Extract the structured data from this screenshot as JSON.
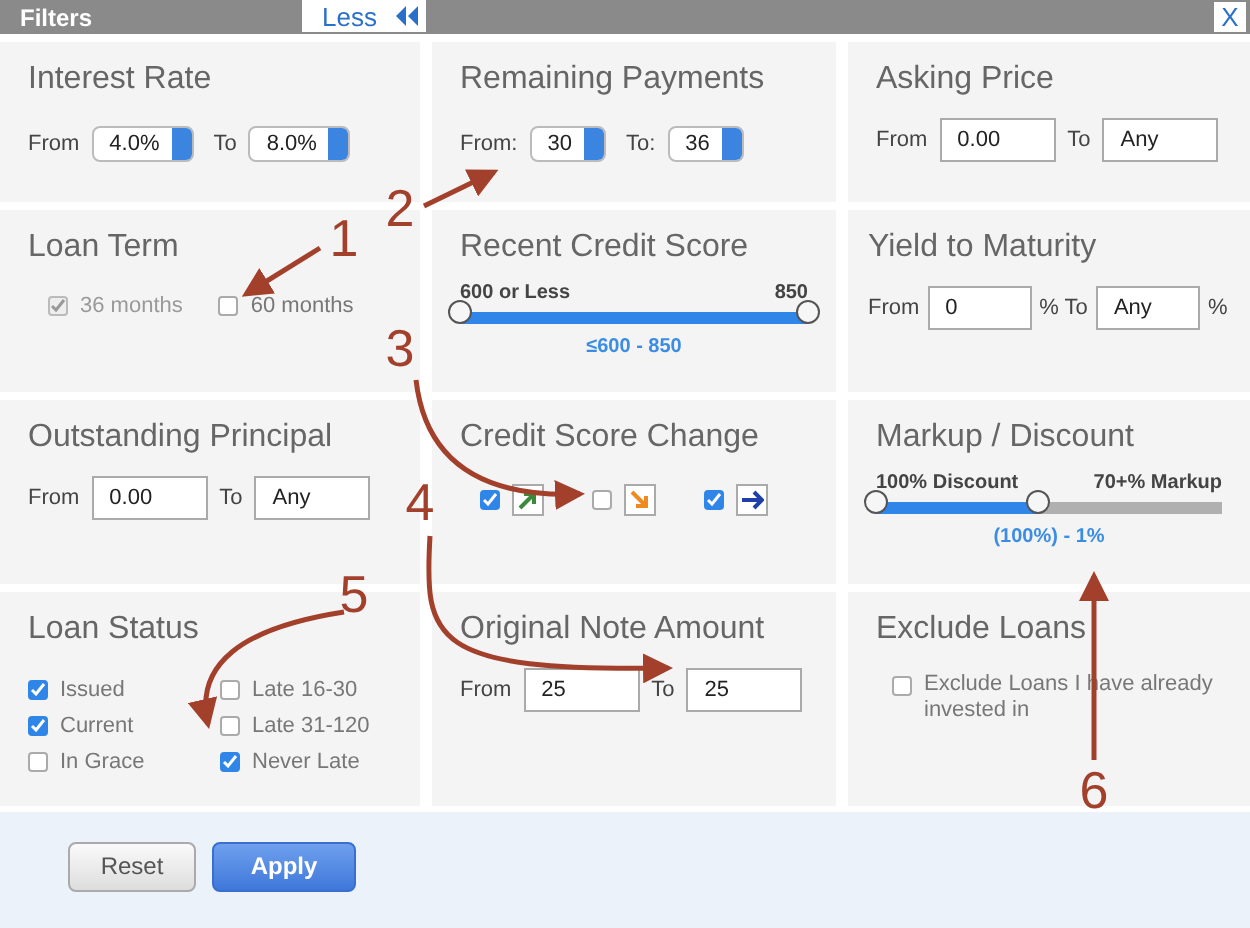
{
  "header": {
    "title": "Filters",
    "toggle": "Less",
    "close": "X"
  },
  "sections": [
    {
      "kind": "select_range",
      "title": "Interest Rate",
      "from_label": "From",
      "from": "4.0%",
      "to_label": "To",
      "to": "8.0%"
    },
    {
      "kind": "select_range",
      "title": "Remaining Payments",
      "from_label": "From:",
      "from": "30",
      "to_label": "To:",
      "to": "36"
    },
    {
      "kind": "text_range",
      "title": "Asking Price",
      "from_label": "From",
      "from": "0.00",
      "to_label": "To",
      "to": "Any"
    },
    {
      "kind": "checks_row",
      "title": "Loan Term",
      "options": [
        {
          "label": "36 months",
          "checked": true,
          "disabled": true
        },
        {
          "label": "60 months",
          "checked": false,
          "disabled": false
        }
      ]
    },
    {
      "kind": "slider",
      "title": "Recent Credit Score",
      "min_label": "600 or Less",
      "max_label": "850",
      "level": 1,
      "reading": "≤600 - 850"
    },
    {
      "kind": "text_range",
      "title": "Yield to Maturity",
      "from_label": "From",
      "from": "0",
      "to_label": "% To",
      "to": "Any",
      "suffix": "%"
    },
    {
      "kind": "text_range",
      "title": "Outstanding Principal",
      "from_label": "From",
      "from": "0.00",
      "to_label": "To",
      "to": "Any"
    },
    {
      "kind": "icon_checks",
      "title": "Credit Score Change",
      "options": [
        {
          "kind": "up",
          "checked": true
        },
        {
          "kind": "down",
          "checked": false
        },
        {
          "kind": "right",
          "checked": true
        }
      ]
    },
    {
      "kind": "slider",
      "title": "Markup / Discount",
      "min_label": "100% Discount",
      "max_label": "70+% Markup",
      "level": 0.47,
      "reading": "(100%) - 1%"
    },
    {
      "kind": "checks_grid",
      "title": "Loan Status",
      "options": [
        {
          "label": "Issued",
          "checked": true,
          "disabled": false
        },
        {
          "label": "Current",
          "checked": true,
          "disabled": false
        },
        {
          "label": "In Grace",
          "checked": false,
          "disabled": false
        },
        {
          "label": "Late 16-30",
          "checked": false,
          "disabled": false
        },
        {
          "label": "Late 31-120",
          "checked": false,
          "disabled": false
        },
        {
          "label": "Never Late",
          "checked": true,
          "disabled": false
        }
      ]
    },
    {
      "kind": "text_range",
      "title": "Original Note Amount",
      "from_label": "From",
      "from": "25",
      "to_label": "To",
      "to": "25"
    },
    {
      "kind": "check_text",
      "title": "Exclude Loans",
      "label": "Exclude Loans I have already invested in",
      "checked": false
    }
  ],
  "buttons": [
    {
      "label": "Reset",
      "kind": "secondary"
    },
    {
      "label": "Apply",
      "kind": "primary"
    }
  ],
  "annotations": [
    {
      "label": "1"
    },
    {
      "label": "2"
    },
    {
      "label": "3"
    },
    {
      "label": "4"
    },
    {
      "label": "5"
    },
    {
      "label": "6"
    }
  ]
}
